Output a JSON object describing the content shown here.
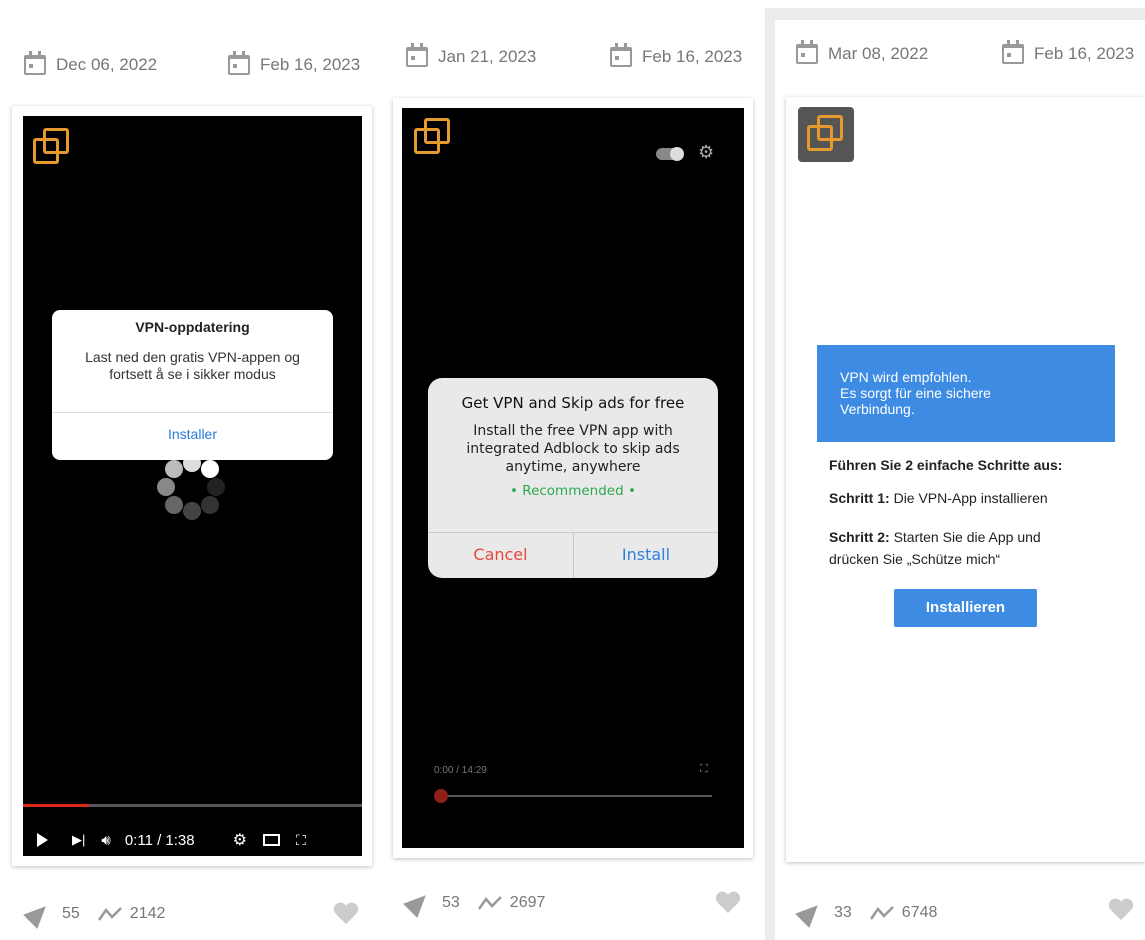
{
  "columns": [
    {
      "date_created": "Dec 06, 2022",
      "date_updated": "Feb 16, 2023",
      "dialog": {
        "title": "VPN-oppdatering",
        "message": "Last ned den gratis VPN-appen og fortsett å se i sikker modus",
        "button": "Installer"
      },
      "player": {
        "time": "0:11 / 1:38",
        "progress": 0.19
      },
      "stats": {
        "shares": "55",
        "views": "2142"
      }
    },
    {
      "date_created": "Jan 21, 2023",
      "date_updated": "Feb 16, 2023",
      "dialog": {
        "title": "Get VPN and Skip ads for free",
        "message": "Install the free VPN app with integrated Adblock to skip ads anytime, anywhere",
        "recommended": "• Recommended •",
        "cancel": "Cancel",
        "install": "Install"
      },
      "player": {
        "time": "0:00 / 14:29",
        "progress": 0.0
      },
      "stats": {
        "shares": "53",
        "views": "2697"
      }
    },
    {
      "date_created": "Mar 08, 2022",
      "date_updated": "Feb 16, 2023",
      "banner": {
        "line1": "VPN wird empfohlen.",
        "line2": "Es sorgt für eine sichere",
        "line3": "Verbindung."
      },
      "heading": "Führen Sie 2 einfache Schritte aus:",
      "step1_label": "Schritt 1:",
      "step1_text": " Die VPN-App installieren",
      "step2_label": "Schritt 2:",
      "step2_text": " Starten Sie die App und",
      "step2_text2": "drücken Sie „Schütze mich“",
      "button": "Installieren",
      "stats": {
        "shares": "33",
        "views": "6748"
      }
    }
  ],
  "colors": {
    "logo_orange": "#e69a2e",
    "progress_red": "#e0281c",
    "ios_blue": "#2f7fe0",
    "ios_red": "#e8483b",
    "recommended_green": "#2fa84f",
    "banner_blue": "#3d8be2"
  }
}
